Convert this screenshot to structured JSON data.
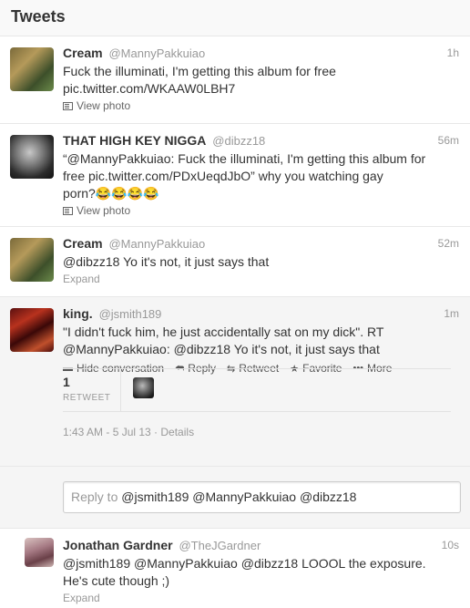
{
  "header": {
    "title": "Tweets"
  },
  "tweets": [
    {
      "fullname": "Cream",
      "username": "@MannyPakkuiao",
      "time": "1h",
      "lines": [
        "Fuck the illuminati, I'm getting this album for free",
        "pic.twitter.com/WKAAW0LBH7"
      ],
      "action": "View photo"
    },
    {
      "fullname": "THAT HIGH KEY NIGGA",
      "username": "@dibzz18",
      "time": "56m",
      "lines": [
        "“@MannyPakkuiao: Fuck the illuminati, I'm getting this album for",
        "free pic.twitter.com/PDxUeqdJbO” why you watching gay",
        "porn?😂😂😂😂"
      ],
      "action": "View photo"
    },
    {
      "fullname": "Cream",
      "username": "@MannyPakkuiao",
      "time": "52m",
      "lines": [
        "@dibzz18 Yo it's not, it just says that"
      ],
      "action": "Expand"
    },
    {
      "fullname": "king.",
      "username": "@jsmith189",
      "time": "1m",
      "lines": [
        "\"I didn't fuck him, he just accidentally sat on my dick\". RT",
        "@MannyPakkuiao: @dibzz18 Yo it's not, it just says that"
      ],
      "actions": {
        "hide": "Hide conversation",
        "reply": "Reply",
        "retweet": "Retweet",
        "favorite": "Favorite",
        "more": "More"
      },
      "stats": {
        "count": "1",
        "label": "RETWEET"
      },
      "datetime": "1:43 AM - 5 Jul 13 · Details"
    },
    {
      "fullname": "Jonathan Gardner",
      "username": "@TheJGardner",
      "time": "10s",
      "lines": [
        "@jsmith189 @MannyPakkuiao @dibzz18 LOOOL the exposure.",
        "He's cute though ;)"
      ],
      "action": "Expand"
    }
  ],
  "reply": {
    "prefix": "Reply to",
    "handles": "@jsmith189 @MannyPakkuiao @dibzz18"
  }
}
